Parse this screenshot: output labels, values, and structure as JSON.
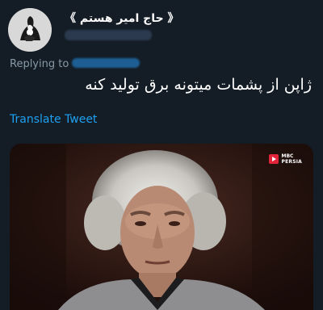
{
  "tweet": {
    "display_name": "《 حاج امیر هستم 》",
    "handle_redacted": true,
    "replying_to_label": "Replying to",
    "reply_handle_redacted": true,
    "text": "ژاپن از پشمات میتونه برق تولید کنه",
    "translate_label": "Translate Tweet"
  },
  "media": {
    "watermark_line1": "MBC",
    "watermark_line2": "PERSIA"
  },
  "colors": {
    "background": "#141d26",
    "link": "#1da1f2",
    "secondary_text": "#8899a6",
    "watermark_red": "#e0243a"
  }
}
